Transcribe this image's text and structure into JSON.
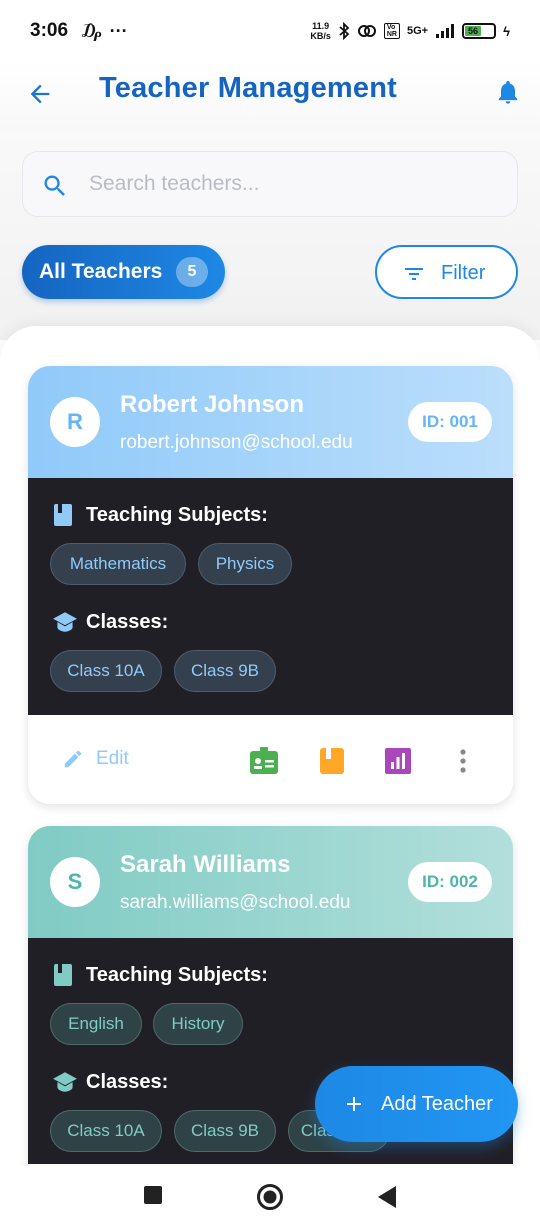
{
  "status": {
    "time": "3:06",
    "net_speed_top": "11.9",
    "net_speed_bottom": "KB/s",
    "network": "5G+",
    "battery": "56"
  },
  "header": {
    "title": "Teacher Management",
    "back_icon": "arrow-left-icon",
    "bell_icon": "bell-icon"
  },
  "search": {
    "placeholder": "Search teachers..."
  },
  "filters": {
    "all_label": "All Teachers",
    "all_count": "5",
    "filter_label": "Filter"
  },
  "labels": {
    "subjects": "Teaching Subjects:",
    "classes": "Classes:",
    "edit": "Edit"
  },
  "teachers": [
    {
      "initial": "R",
      "name": "Robert Johnson",
      "email": "robert.johnson@school.edu",
      "id": "ID: 001",
      "subjects": [
        "Mathematics",
        "Physics"
      ],
      "classes": [
        "Class 10A",
        "Class 9B"
      ]
    },
    {
      "initial": "S",
      "name": "Sarah Williams",
      "email": "sarah.williams@school.edu",
      "id": "ID: 002",
      "subjects": [
        "English",
        "History"
      ],
      "classes": [
        "Class 10A",
        "Class 9B",
        "Class 11A"
      ]
    }
  ],
  "fab": {
    "label": "Add Teacher"
  },
  "colors": {
    "primary": "#1565c0",
    "accent": "#1e88e5",
    "card1_header": "#90caf9",
    "card2_header": "#80cbc4",
    "card_body": "#211f26"
  }
}
